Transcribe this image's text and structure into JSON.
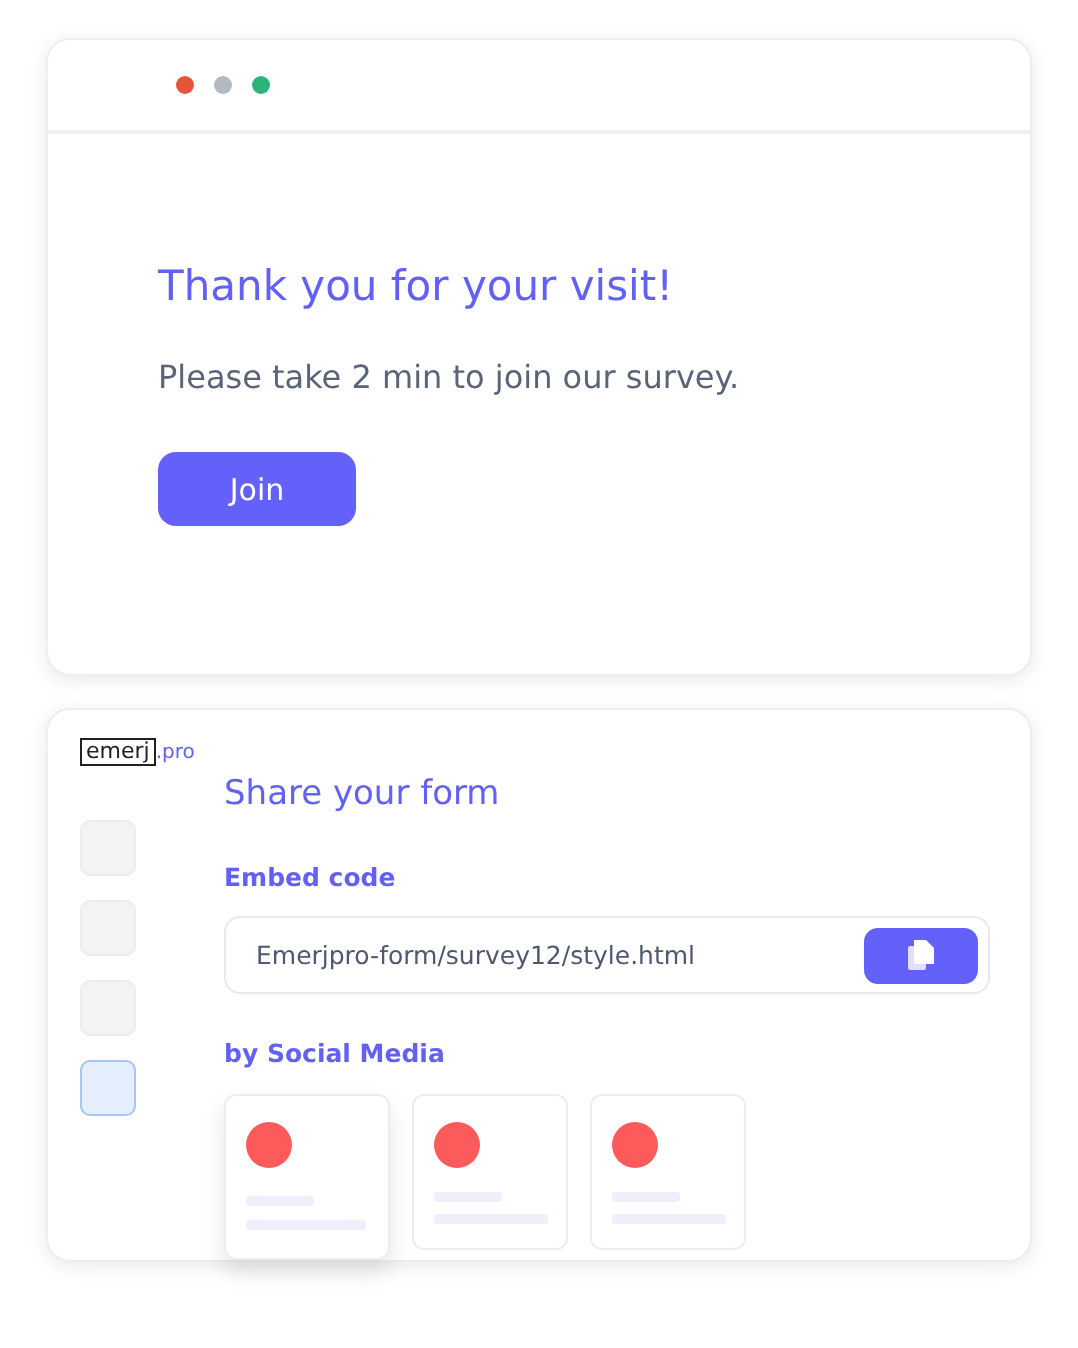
{
  "window": {
    "dots": [
      {
        "color": "#e8543a"
      },
      {
        "color": "#b3b8c4"
      },
      {
        "color": "#2db37a"
      }
    ]
  },
  "popup": {
    "title": "Thank you for your visit!",
    "message": "Please take 2 min to join our survey.",
    "button": "Join"
  },
  "logo": {
    "boxed": "emerj",
    "suffix": ".pro"
  },
  "sidebar": {
    "items": [
      {
        "selected": false
      },
      {
        "selected": false
      },
      {
        "selected": false
      },
      {
        "selected": true
      }
    ]
  },
  "share": {
    "title": "Share your form",
    "embed_label": "Embed code",
    "embed_value": "Emerjpro-form/survey12/style.html",
    "social_label": "by Social Media",
    "cards": [
      {
        "selected": true
      },
      {
        "selected": false
      },
      {
        "selected": false
      }
    ]
  }
}
